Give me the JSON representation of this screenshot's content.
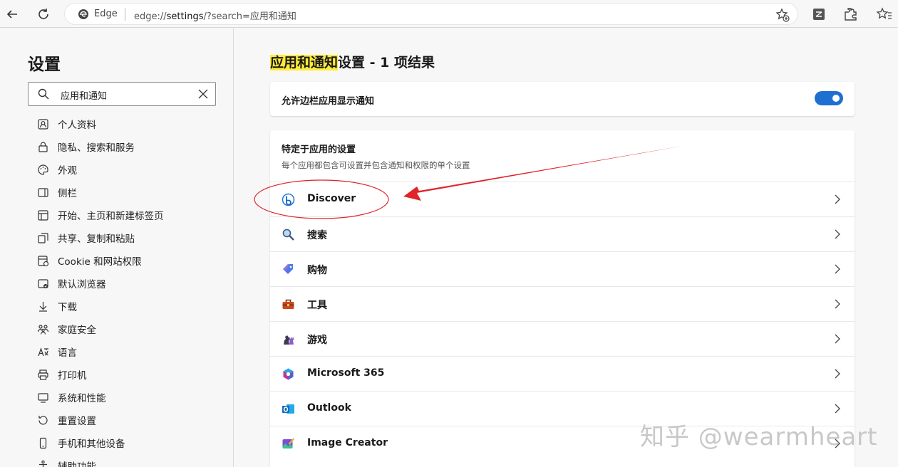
{
  "browser": {
    "site_label": "Edge",
    "url_prefix": "edge://",
    "url_host": "settings",
    "url_rest": "/?search=应用和通知"
  },
  "sidebar": {
    "title": "设置",
    "search_value": "应用和通知",
    "items": [
      {
        "label": "个人资料",
        "icon": "profile-icon"
      },
      {
        "label": "隐私、搜索和服务",
        "icon": "lock-icon"
      },
      {
        "label": "外观",
        "icon": "palette-icon"
      },
      {
        "label": "侧栏",
        "icon": "sidebar-icon"
      },
      {
        "label": "开始、主页和新建标签页",
        "icon": "home-grid-icon"
      },
      {
        "label": "共享、复制和粘贴",
        "icon": "share-icon"
      },
      {
        "label": "Cookie 和网站权限",
        "icon": "cookie-icon"
      },
      {
        "label": "默认浏览器",
        "icon": "browser-icon"
      },
      {
        "label": "下载",
        "icon": "download-icon"
      },
      {
        "label": "家庭安全",
        "icon": "family-icon"
      },
      {
        "label": "语言",
        "icon": "language-icon"
      },
      {
        "label": "打印机",
        "icon": "printer-icon"
      },
      {
        "label": "系统和性能",
        "icon": "system-icon"
      },
      {
        "label": "重置设置",
        "icon": "reset-icon"
      },
      {
        "label": "手机和其他设备",
        "icon": "phone-icon"
      },
      {
        "label": "辅助功能",
        "icon": "accessibility-icon"
      }
    ]
  },
  "main": {
    "title_highlight": "应用和通知",
    "title_rest": "设置 - 1 项结果",
    "sidebar_notify_label": "允许边栏应用显示通知",
    "sidebar_notify_enabled": true,
    "section_title": "特定于应用的设置",
    "section_subtitle": "每个应用都包含可设置并包含通知和权限的单个设置",
    "apps": [
      {
        "label": "Discover",
        "icon": "discover-icon"
      },
      {
        "label": "搜索",
        "icon": "search-app-icon"
      },
      {
        "label": "购物",
        "icon": "shopping-tag-icon"
      },
      {
        "label": "工具",
        "icon": "toolbox-icon"
      },
      {
        "label": "游戏",
        "icon": "games-icon"
      },
      {
        "label": "Microsoft 365",
        "icon": "m365-icon"
      },
      {
        "label": "Outlook",
        "icon": "outlook-icon"
      },
      {
        "label": "Image Creator",
        "icon": "image-creator-icon"
      }
    ]
  },
  "watermark": "知乎 @wearmheart",
  "colors": {
    "accent": "#1e6fd0",
    "highlight": "#ffeb3b",
    "annotation": "#e0242b"
  }
}
